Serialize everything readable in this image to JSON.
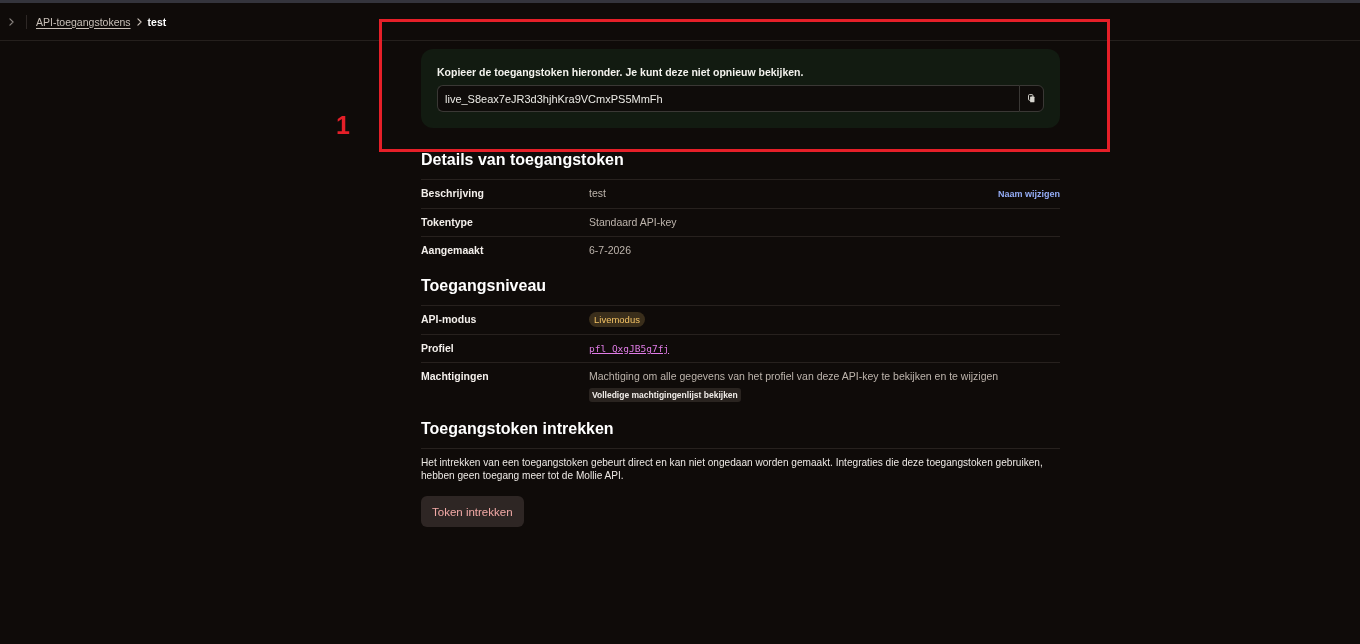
{
  "breadcrumb": {
    "items": [
      {
        "label": "API-toegangstokens",
        "kind": "link"
      },
      {
        "label": "test",
        "kind": "current"
      }
    ]
  },
  "annotation": {
    "label": "1"
  },
  "token_notice": {
    "message": "Kopieer de toegangstoken hieronder. Je kunt deze niet opnieuw bekijken.",
    "token": "live_S8eax7eJR3d3hjhKra9VCmxPS5MmFh"
  },
  "sections": [
    {
      "title": "Details van toegangstoken",
      "rows": [
        {
          "label": "Beschrijving",
          "value": "test",
          "kind": "text",
          "action": "Naam wijzigen"
        },
        {
          "label": "Tokentype",
          "value": "Standaard API-key",
          "kind": "text"
        },
        {
          "label": "Aangemaakt",
          "value": "6-7-2026",
          "kind": "text"
        }
      ]
    },
    {
      "title": "Toegangsniveau",
      "rows": [
        {
          "label": "API-modus",
          "value": "Livemodus",
          "kind": "badge"
        },
        {
          "label": "Profiel",
          "value": "pfl_QxgJB5g7fj",
          "kind": "link"
        },
        {
          "label": "Machtigingen",
          "value": "Machtiging om alle gegevens van het profiel van deze API-key te bekijken en te wijzigen",
          "kind": "text",
          "button": "Volledige machtigingenlijst bekijken"
        }
      ]
    },
    {
      "title": "Toegangstoken intrekken",
      "description": "Het intrekken van een toegangstoken gebeurt direct en kan niet ongedaan worden gemaakt. Integraties die deze toegangstoken gebruiken, hebben geen toegang meer tot de Mollie API.",
      "button": "Token intrekken"
    }
  ]
}
